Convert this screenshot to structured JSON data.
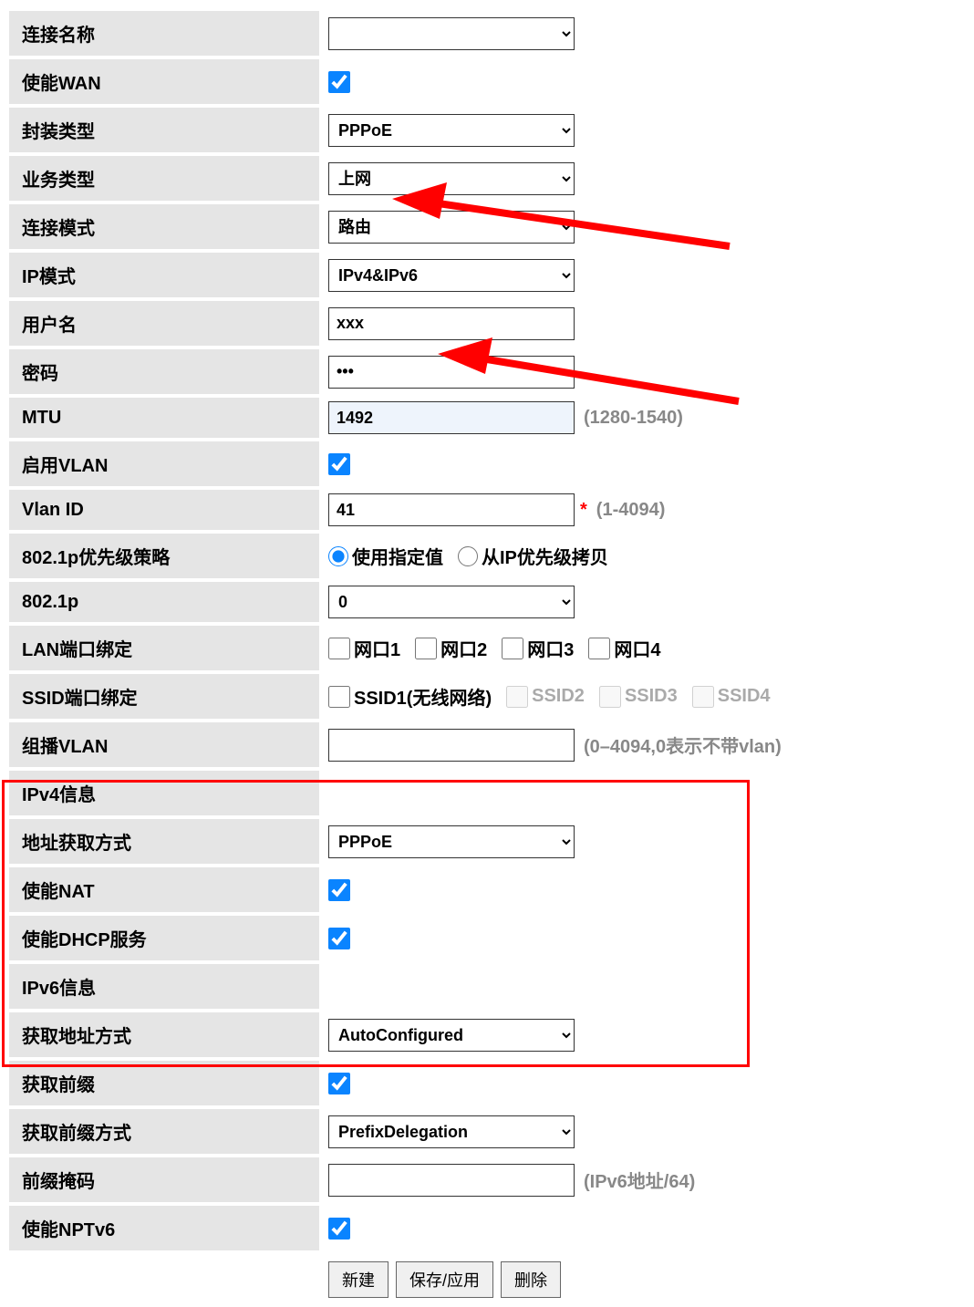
{
  "labels": {
    "conn_name": "连接名称",
    "enable_wan": "使能WAN",
    "encap_type": "封装类型",
    "service_type": "业务类型",
    "conn_mode": "连接模式",
    "ip_mode": "IP模式",
    "username": "用户名",
    "password": "密码",
    "mtu": "MTU",
    "enable_vlan": "启用VLAN",
    "vlan_id": "Vlan ID",
    "p8021_policy": "802.1p优先级策略",
    "p8021": "802.1p",
    "lan_bind": "LAN端口绑定",
    "ssid_bind": "SSID端口绑定",
    "multicast_vlan": "组播VLAN",
    "ipv4_info": "IPv4信息",
    "addr_mode": "地址获取方式",
    "enable_nat": "使能NAT",
    "enable_dhcp": "使能DHCP服务",
    "ipv6_info": "IPv6信息",
    "ipv6_addr_mode": "获取地址方式",
    "get_prefix": "获取前缀",
    "prefix_mode": "获取前缀方式",
    "prefix_mask": "前缀掩码",
    "enable_nptv6": "使能NPTv6"
  },
  "values": {
    "conn_name": "",
    "encap_type": "PPPoE",
    "service_type": "上网",
    "conn_mode": "路由",
    "ip_mode": "IPv4&IPv6",
    "username": "xxx",
    "password": "•••",
    "mtu": "1492",
    "vlan_id": "41",
    "p8021": "0",
    "multicast_vlan": "",
    "addr_mode": "PPPoE",
    "ipv6_addr_mode": "AutoConfigured",
    "prefix_mode": "PrefixDelegation",
    "prefix_mask": ""
  },
  "hints": {
    "mtu": "(1280-1540)",
    "vlan_id": "(1-4094)",
    "multicast_vlan": "(0–4094,0表示不带vlan)",
    "prefix_mask": "(IPv6地址/64)"
  },
  "radio": {
    "use_specified": "使用指定值",
    "copy_from_ip": "从IP优先级拷贝"
  },
  "lan_ports": {
    "p1": "网口1",
    "p2": "网口2",
    "p3": "网口3",
    "p4": "网口4"
  },
  "ssid_ports": {
    "s1": "SSID1(无线网络)",
    "s2": "SSID2",
    "s3": "SSID3",
    "s4": "SSID4"
  },
  "buttons": {
    "new": "新建",
    "save": "保存/应用",
    "delete": "删除"
  }
}
